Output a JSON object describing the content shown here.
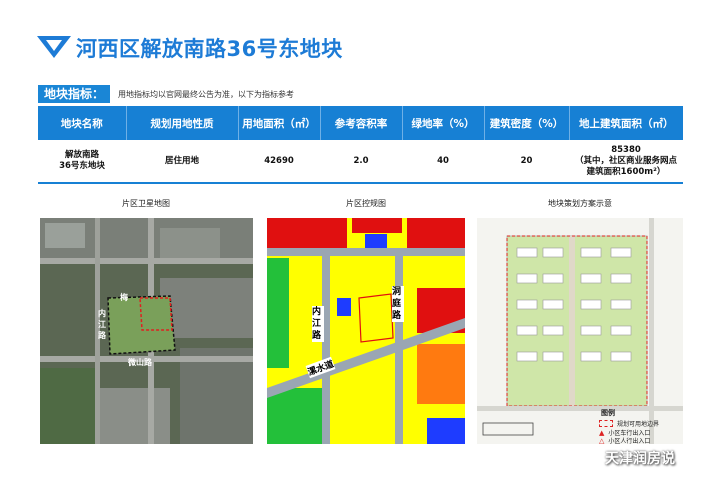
{
  "header": {
    "title": "河西区解放南路36号东地块"
  },
  "indicator": {
    "label": "地块指标：",
    "note": "用地指标均以官网最终公告为准，以下为指标参考"
  },
  "table": {
    "headers": [
      "地块名称",
      "规划用地性质",
      "用地面积（㎡）",
      "参考容积率",
      "绿地率（%）",
      "建筑密度（%）",
      "地上建筑面积（㎡）"
    ],
    "row": {
      "name_line1": "解放南路",
      "name_line2": "36号东地块",
      "use": "居住用地",
      "area": "42690",
      "far": "2.0",
      "green": "40",
      "density": "20",
      "gfa_line1": "85380",
      "gfa_line2": "（其中，社区商业服务网点",
      "gfa_line3": "建筑面积1600m²）"
    }
  },
  "captions": {
    "satellite": "片区卫星地图",
    "control": "片区控规图",
    "scheme": "地块策划方案示意"
  },
  "satellite_labels": {
    "road_top": "梅",
    "road_left": "内江路",
    "road_bottom": "微山路"
  },
  "control_labels": {
    "neijiang": "内江路",
    "dongting": "洞庭路",
    "liaoshui": "漯水道"
  },
  "scheme_legend": {
    "title": "图例",
    "boundary": "规划可用地边界",
    "vehicle": "小区车行出入口",
    "pedestrian": "小区人行出入口"
  },
  "watermark": "天津润房说",
  "colors": {
    "brand_blue": "#1780d4",
    "title_blue": "#1d7bd6"
  }
}
